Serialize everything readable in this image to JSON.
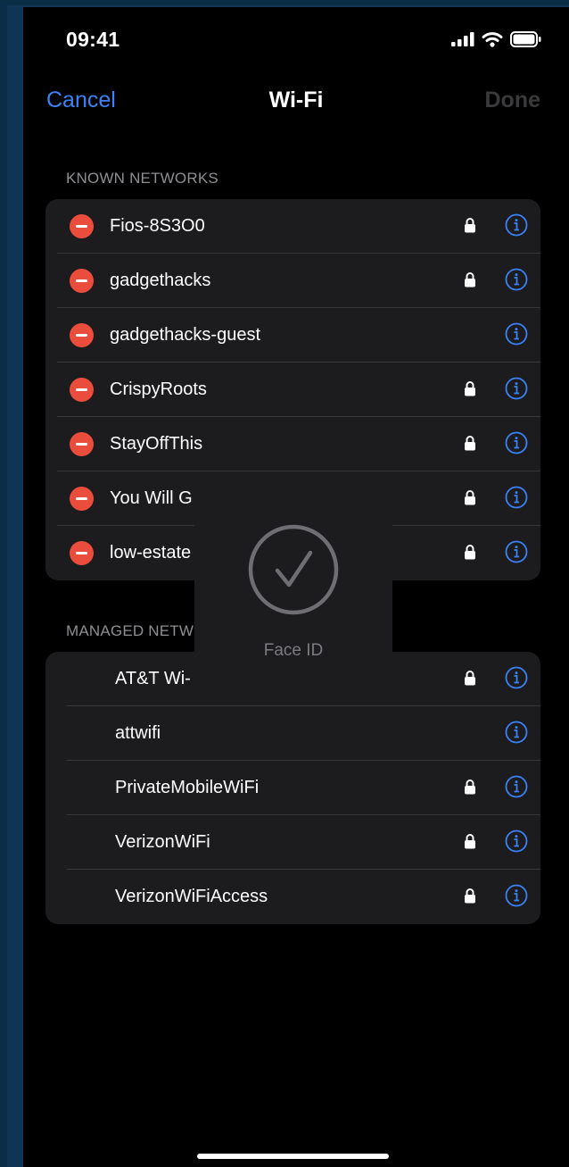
{
  "status": {
    "time": "09:41"
  },
  "nav": {
    "cancel": "Cancel",
    "title": "Wi-Fi",
    "done": "Done"
  },
  "known": {
    "header": "KNOWN NETWORKS",
    "networks": [
      {
        "name": "Fios-8S3O0",
        "locked": true
      },
      {
        "name": "gadgethacks",
        "locked": true
      },
      {
        "name": "gadgethacks-guest",
        "locked": false
      },
      {
        "name": "CrispyRoots",
        "locked": true
      },
      {
        "name": "StayOffThis",
        "locked": true
      },
      {
        "name": "You Will G",
        "locked": true
      },
      {
        "name": "low-estate",
        "locked": true
      }
    ]
  },
  "managed": {
    "header": "MANAGED NETW",
    "networks": [
      {
        "name": "AT&T Wi-",
        "locked": true
      },
      {
        "name": "attwifi",
        "locked": false
      },
      {
        "name": "PrivateMobileWiFi",
        "locked": true
      },
      {
        "name": "VerizonWiFi",
        "locked": true
      },
      {
        "name": "VerizonWiFiAccess",
        "locked": true
      }
    ]
  },
  "face_id": {
    "label": "Face ID"
  },
  "colors": {
    "accent": "#3b82f6",
    "delete": "#eb4d3d",
    "background": "#000000",
    "card": "#1c1c1e"
  }
}
